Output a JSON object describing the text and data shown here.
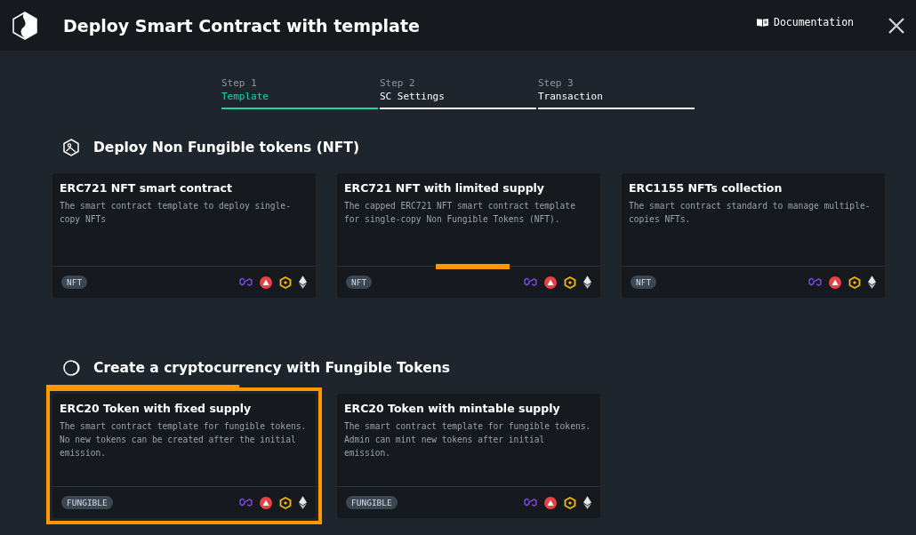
{
  "header": {
    "title": "Deploy Smart Contract with template",
    "documentation": "Documentation"
  },
  "steps": [
    {
      "step": "Step 1",
      "label": "Template",
      "selected": true
    },
    {
      "step": "Step 2",
      "label": "SC Settings",
      "selected": false
    },
    {
      "step": "Step 3",
      "label": "Transaction",
      "selected": false
    }
  ],
  "sections": [
    {
      "kind": "nft",
      "title": "Deploy Non Fungible tokens (NFT)",
      "cards": [
        {
          "title": "ERC721 NFT smart contract",
          "description": "The smart contract template to deploy single-copy NFTs",
          "tag": "NFT",
          "selected": false,
          "hovered": false
        },
        {
          "title": "ERC721 NFT with limited supply",
          "description": "The capped ERC721 NFT smart contract template for single-copy Non Fungible Tokens (NFT).",
          "tag": "NFT",
          "selected": false,
          "hovered": true
        },
        {
          "title": "ERC1155 NFTs collection",
          "description": "The smart contract standard to manage multiple-copies NFTs.",
          "tag": "NFT",
          "selected": false,
          "hovered": false
        }
      ]
    },
    {
      "kind": "fungible",
      "title": "Create a cryptocurrency with Fungible Tokens",
      "cards": [
        {
          "title": "ERC20 Token with fixed supply",
          "description": "The smart contract template for fungible tokens. No new tokens can be created after the initial emission.",
          "tag": "FUNGIBLE",
          "selected": true,
          "hovered": false
        },
        {
          "title": "ERC20 Token with mintable supply",
          "description": "The smart contract template for fungible tokens. Admin can mint new tokens after initial emission.",
          "tag": "FUNGIBLE",
          "selected": false,
          "hovered": false
        }
      ]
    }
  ]
}
